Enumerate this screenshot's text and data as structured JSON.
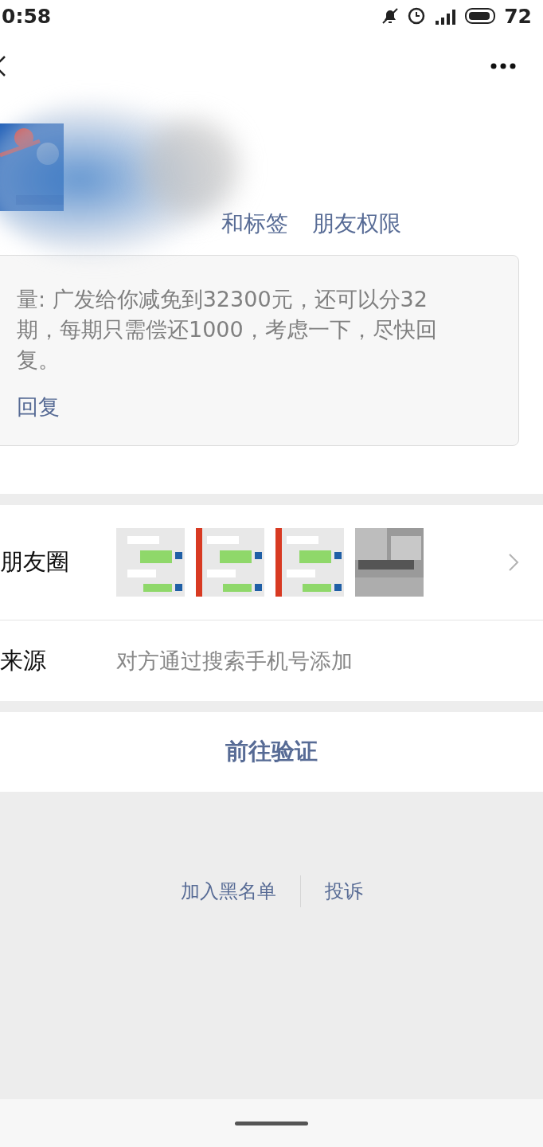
{
  "status_bar": {
    "time": "0:58",
    "battery": "72"
  },
  "profile": {
    "tabs": [
      {
        "label": "和标签"
      },
      {
        "label": "朋友权限"
      }
    ]
  },
  "message": {
    "text": "量: 广发给你减免到32300元，还可以分32期，每期只需偿还1000，考虑一下，尽快回复。",
    "reply": "回复"
  },
  "moments": {
    "label": "朋友圈"
  },
  "source": {
    "label": "来源",
    "value": "对方通过搜索手机号添加"
  },
  "verify_button": "前往验证",
  "footer_links": [
    "加入黑名单",
    "投诉"
  ]
}
